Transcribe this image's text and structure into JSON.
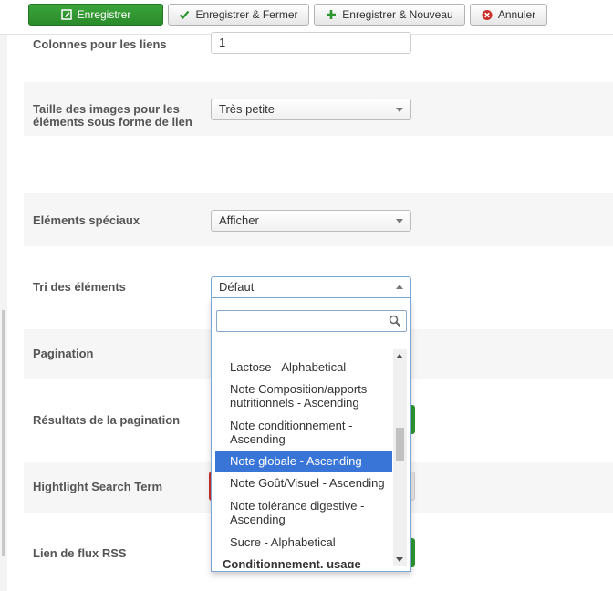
{
  "toolbar": {
    "save_label": "Enregistrer",
    "save_close_label": "Enregistrer & Fermer",
    "save_new_label": "Enregistrer & Nouveau",
    "cancel_label": "Annuler"
  },
  "fields": {
    "link_columns": {
      "label": "Colonnes pour les liens",
      "value": "1"
    },
    "link_image_size": {
      "label_line1": "Taille des images pour les",
      "label_line2": "éléments sous forme de lien",
      "value": "Très petite"
    },
    "special_items": {
      "label": "Eléments spéciaux",
      "value": "Afficher"
    },
    "item_sort": {
      "label": "Tri des éléments",
      "value": "Défaut"
    },
    "pagination": {
      "label": "Pagination"
    },
    "pagination_results": {
      "label": "Résultats de la pagination"
    },
    "highlight": {
      "label": "Hightlight Search Term"
    },
    "rss": {
      "label": "Lien de flux RSS"
    }
  },
  "dropdown": {
    "search_value": "",
    "options": [
      {
        "line1": "Lactose - Alphabetical",
        "line2": ""
      },
      {
        "line1": "Note Composition/apports",
        "line2": "nutritionnels - Ascending"
      },
      {
        "line1": "Note conditionnement -",
        "line2": "Ascending"
      },
      {
        "line1": "Note globale - Ascending",
        "line2": "",
        "selected": true
      },
      {
        "line1": "Note Goût/Visuel - Ascending",
        "line2": ""
      },
      {
        "line1": "Note tolérance digestive -",
        "line2": "Ascending"
      },
      {
        "line1": "Sucre - Alphabetical",
        "line2": ""
      }
    ],
    "group_label": "Conditionnement, usage"
  },
  "colors": {
    "primary_green": "#2f962f",
    "highlight_blue": "#3875d7",
    "cancel_red": "#c9302c"
  }
}
